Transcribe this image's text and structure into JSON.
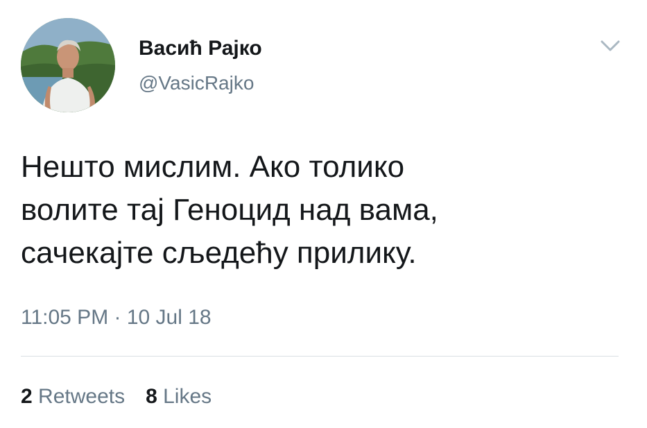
{
  "user": {
    "display_name": "Васић Рајко",
    "handle": "@VasicRajko",
    "avatar_icon": "profile-photo"
  },
  "tweet": {
    "text_lines": [
      "Нешто мислим. Ако толико",
      "волите тај Геноцид над вама,",
      "сачекајте сљедећу прилику."
    ],
    "timestamp": "11:05 PM · 10 Jul 18"
  },
  "stats": {
    "retweets_count": "2",
    "retweets_label": "Retweets",
    "likes_count": "8",
    "likes_label": "Likes"
  },
  "colors": {
    "text_primary": "#14171a",
    "text_secondary": "#657786",
    "divider": "#d9dfe3",
    "caret": "#aab8c2"
  },
  "icons": {
    "menu": "chevron-down-icon"
  }
}
